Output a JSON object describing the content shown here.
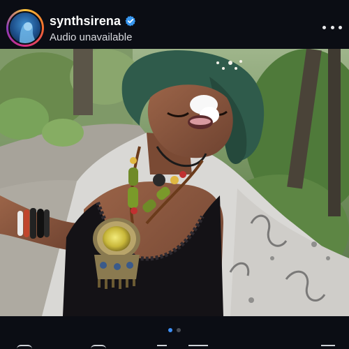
{
  "post": {
    "username": "synthsirena",
    "subtitle": "Audio unavailable",
    "verified": true,
    "icons": {
      "avatar": "profile-photo",
      "verified": "verified-badge-icon",
      "more": "more-horizontal-icon"
    }
  },
  "carousel": {
    "total": 2,
    "active_index": 0
  },
  "colors": {
    "background": "#0b0d14",
    "verified_blue": "#3897f0",
    "active_dot": "#3e8ff5",
    "inactive_dot": "#4a4d55"
  }
}
